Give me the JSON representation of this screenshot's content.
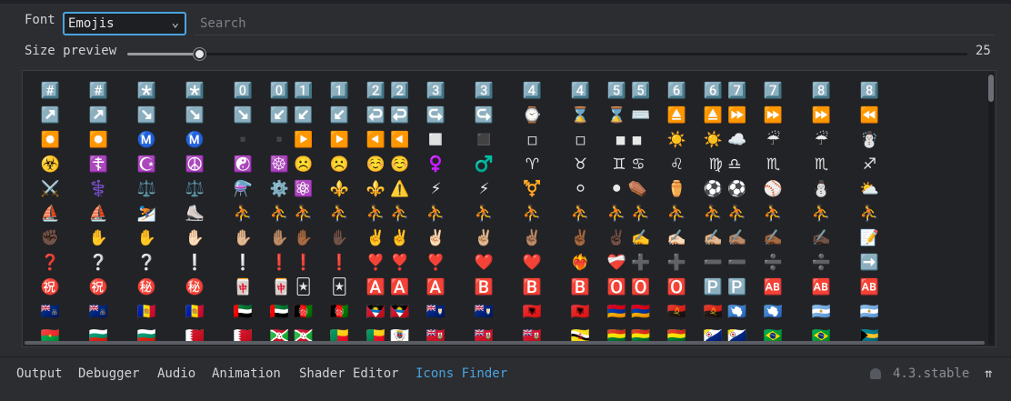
{
  "toolbar": {
    "font_label": "Font",
    "font_value": "Emojis",
    "search_placeholder": "Search",
    "size_label": "Size preview",
    "size_value": "25",
    "size_fraction": 0.085
  },
  "glyph_rows": [
    [
      "#️⃣",
      "#️⃣",
      "*️⃣",
      "*️⃣",
      "0️⃣",
      "0️⃣ 1️⃣",
      "1️⃣",
      "2️⃣ 2️⃣",
      "3️⃣",
      "3️⃣",
      "4️⃣",
      "4️⃣",
      "5️⃣ 5️⃣",
      "6️⃣",
      "6️⃣ 7️⃣",
      "7️⃣",
      "8️⃣",
      "8️⃣"
    ],
    [
      "↗️",
      "↗️",
      "↘️",
      "↘️",
      "↘️",
      "↙️ ↙️",
      "↙️",
      "↩️ ↩️",
      "↪️",
      "↪️",
      "⌚",
      "⌛",
      "⌛ ⌨️",
      "⏏️",
      "⏏️ ⏩",
      "⏩",
      "⏩",
      "⏪"
    ],
    [
      "⏺️",
      "⏺️",
      "Ⓜ️",
      "Ⓜ️",
      "▪️",
      "▪️ ▶️",
      "▶️",
      "◀️ ◀️",
      "◻️",
      "◼️",
      "◽",
      "◽",
      "◾ ◾",
      "☀️",
      "☀️ ☁️",
      "☔",
      "☔",
      "☃️"
    ],
    [
      "☣️",
      "☦️",
      "☪️",
      "☮️",
      "☯️",
      "☸️ ☹️",
      "☹️",
      "☺️ ☺️",
      "♀️",
      "♂️",
      "♈",
      "♉",
      "♊ ♋",
      "♌",
      "♍ ♎",
      "♏",
      "♏",
      "♐"
    ],
    [
      "⚔️",
      "⚕️",
      "⚖️",
      "⚖️",
      "⚗️",
      "⚙️ ⚛️",
      "⚜️",
      "⚜️ ⚠️",
      "⚡",
      "⚡",
      "⚧️",
      "⚪",
      "⚫ ⚰️",
      "⚱️",
      "⚽ ⚽",
      "⚾",
      "⛄",
      "⛅"
    ],
    [
      "⛵",
      "⛵",
      "⛷️",
      "⛸️",
      "⛹️",
      "⛹️ ⛹️",
      "⛹️",
      "⛹️ ⛹️",
      "⛹️",
      "⛹️",
      "⛹️",
      "⛹️",
      "⛹️ ⛹️",
      "⛹️",
      "⛹️ ⛹️",
      "⛹️",
      "⛹️",
      "⛹️"
    ],
    [
      "✊🏿",
      "✋",
      "✋",
      "✋🏻",
      "✋🏼",
      "✋🏽 ✋🏾",
      "✋🏿",
      "✌️ ✌️",
      "✌🏻",
      "✌🏼",
      "✌🏽",
      "✌🏾",
      "✌🏿 ✍️",
      "✍🏻",
      "✍🏼 ✍🏽",
      "✍🏾",
      "✍🏿",
      "📝"
    ],
    [
      "❓",
      "❔",
      "❔",
      "❕",
      "❕",
      "❗ ❗",
      "❗",
      "❣️ ❣️",
      "❣️",
      "❤️",
      "❤️",
      "❤️‍🔥",
      "❤️‍🩹 ➕",
      "➕",
      "➖ ➖",
      "➗",
      "➗",
      "➡️"
    ],
    [
      "㊗️",
      "㊗️",
      "㊙️",
      "㊙️",
      "🀄",
      "🀄 🃏",
      "🃏",
      "🅰️ 🅰️",
      "🅰️",
      "🅱️",
      "🅱️",
      "🅱️",
      "🅾️ 🅾️",
      "🅾️",
      "🅿️ 🅿️",
      "🆎",
      "🆎",
      "🆎"
    ],
    [
      "🇦🇨",
      "🇦🇨",
      "🇦🇩",
      "🇦🇩",
      "🇦🇪",
      "🇦🇪 🇦🇫",
      "🇦🇫",
      "🇦🇬 🇦🇬",
      "🇦🇮",
      "🇦🇮",
      "🇦🇱",
      "🇦🇱",
      "🇦🇲 🇦🇲",
      "🇦🇴",
      "🇦🇴 🇦🇶",
      "🇦🇶",
      "🇦🇷",
      "🇦🇷"
    ],
    [
      "🇧🇫",
      "🇧🇬",
      "🇧🇬",
      "🇧🇭",
      "🇧🇭",
      "🇧🇮 🇧🇮",
      "🇧🇯",
      "🇧🇯 🇧🇱",
      "🇧🇲",
      "🇧🇲",
      "🇧🇲",
      "🇧🇳",
      "🇧🇴 🇧🇴",
      "🇧🇴",
      "🇧🇶 🇧🇶",
      "🇧🇷",
      "🇧🇷",
      "🇧🇸"
    ]
  ],
  "tabs": [
    {
      "label": "Output",
      "active": false
    },
    {
      "label": "Debugger",
      "active": false
    },
    {
      "label": "Audio",
      "active": false
    },
    {
      "label": "Animation",
      "active": false
    },
    {
      "label": "Shader Editor",
      "active": false
    },
    {
      "label": "Icons Finder",
      "active": true
    }
  ],
  "status": {
    "version": "4.3.stable"
  },
  "colors": {
    "accent": "#4aa3df",
    "panel_bg": "#2b2d31",
    "grid_bg": "#222327"
  },
  "icons": {
    "select_chevron": "chevron-down-icon",
    "notification": "bell-icon",
    "expand": "expand-panel-icon"
  }
}
